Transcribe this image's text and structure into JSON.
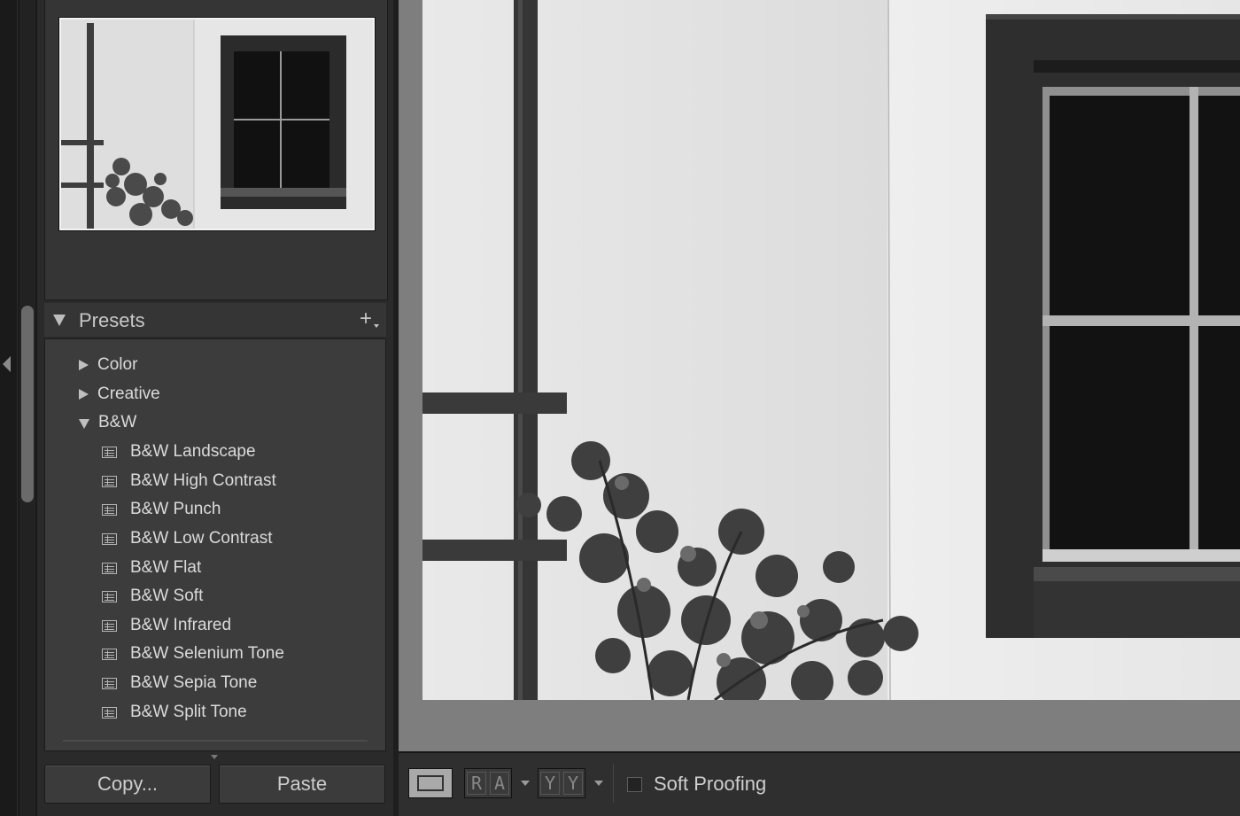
{
  "presets_panel": {
    "title": "Presets",
    "folders": [
      {
        "label": "Color"
      },
      {
        "label": "Creative"
      },
      {
        "label": "B&W"
      }
    ],
    "bw_presets": [
      "B&W Landscape",
      "B&W High Contrast",
      "B&W Punch",
      "B&W Low Contrast",
      "B&W Flat",
      "B&W Soft",
      "B&W Infrared",
      "B&W Selenium Tone",
      "B&W Sepia Tone",
      "B&W Split Tone"
    ]
  },
  "bottom_buttons": {
    "copy_label": "Copy...",
    "paste_label": "Paste"
  },
  "toolbar": {
    "before_after_lr_glyphs": [
      "R",
      "A"
    ],
    "before_after_tb_glyphs": [
      "Y",
      "Y"
    ],
    "soft_proofing_label": "Soft Proofing",
    "soft_proofing_checked": false
  },
  "icons": {
    "collapse": "chevron-left-icon",
    "folder_collapsed": "triangle-right-icon",
    "folder_expanded": "triangle-down-icon",
    "preset": "preset-list-icon",
    "add": "plus-icon"
  }
}
